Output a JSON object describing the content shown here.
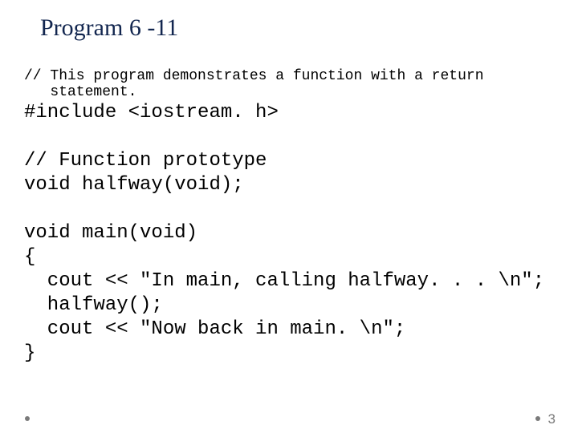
{
  "title": "Program 6 -11",
  "code": {
    "comment_header": "// This program demonstrates a function with a return\n   statement.",
    "include": "#include <iostream. h>",
    "proto_c": "// Function prototype",
    "proto": "void halfway(void);",
    "main_sig": "void main(void)",
    "brace_o": "{",
    "m1": "  cout << \"In main, calling halfway. . . \\n\";",
    "m2": "  halfway();",
    "m3": "  cout << \"Now back in main. \\n\";",
    "brace_c": "}"
  },
  "page_number": "3"
}
